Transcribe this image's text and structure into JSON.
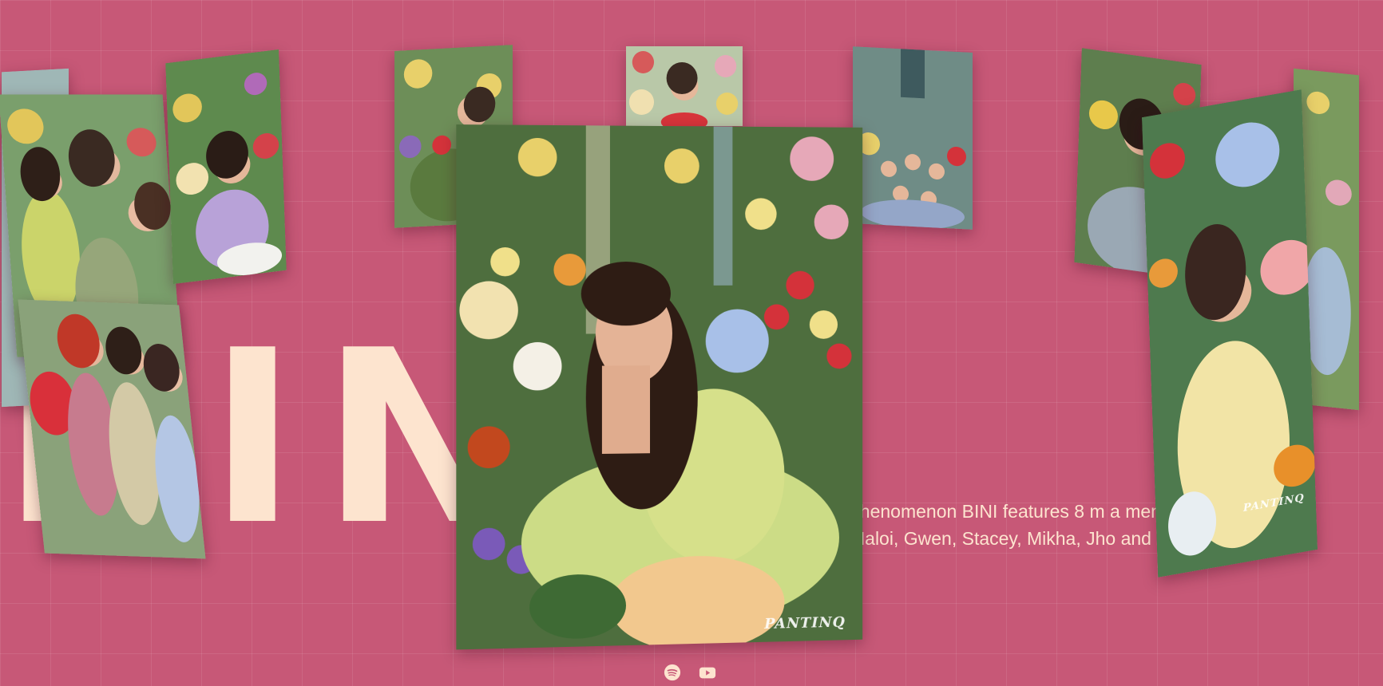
{
  "hero": {
    "title": "BINI"
  },
  "description": {
    "line1": "phenomenon BINI features 8 m          a members,",
    "line2": "Maloi, Gwen, Stacey, Mikha, Jho         and Sheena."
  },
  "gallery": {
    "watermark": "PANTINQ"
  },
  "social": {
    "icons": [
      "spotify-icon",
      "youtube-icon"
    ]
  },
  "colors": {
    "background": "#c75877",
    "title": "#fde4cf",
    "text": "#fde4cf"
  }
}
